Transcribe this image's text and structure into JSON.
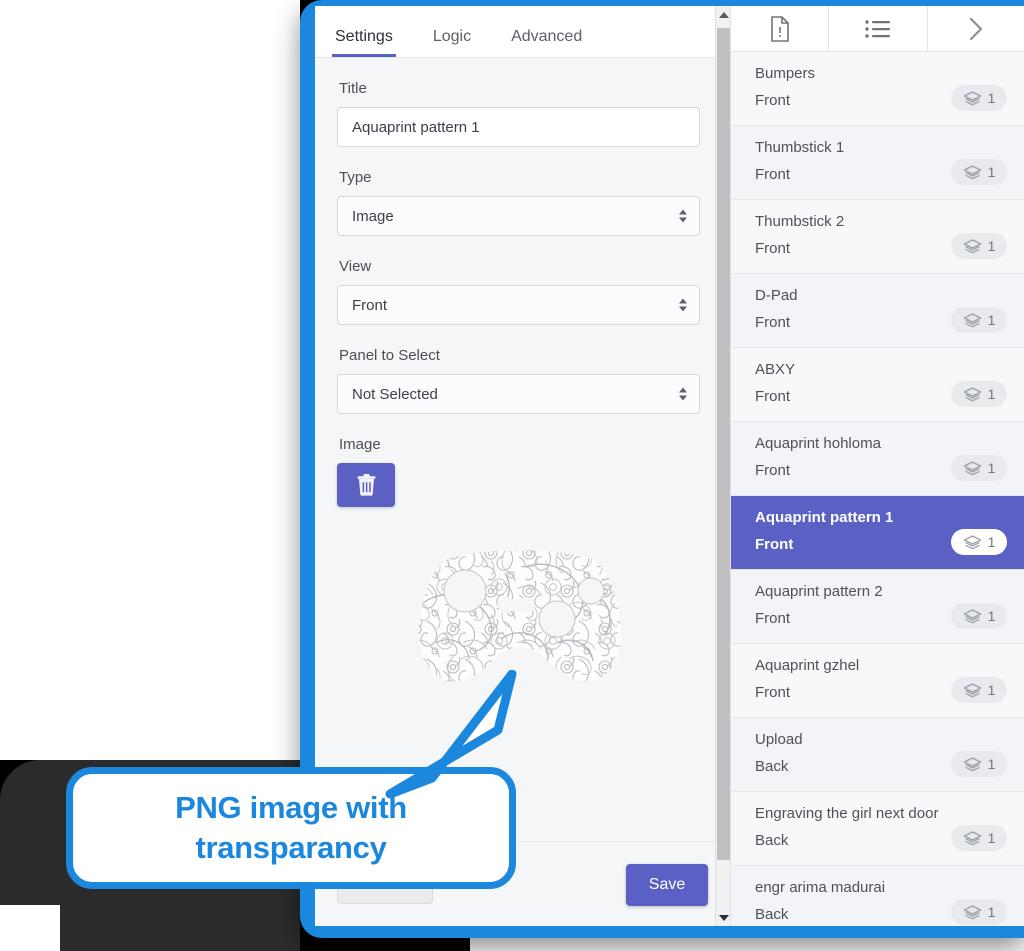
{
  "window": {
    "frame_color": "#1b87dd",
    "accent_color": "#5b61c4"
  },
  "settings_panel": {
    "tabs": [
      {
        "label": "Settings",
        "active": true
      },
      {
        "label": "Logic",
        "active": false
      },
      {
        "label": "Advanced",
        "active": false
      }
    ],
    "fields": {
      "title": {
        "label": "Title",
        "value": "Aquaprint pattern 1",
        "placeholder": "Title"
      },
      "type": {
        "label": "Type",
        "value": "Image"
      },
      "view": {
        "label": "View",
        "value": "Front"
      },
      "panel_to_select": {
        "label": "Panel to Select",
        "value": "Not Selected"
      },
      "image": {
        "label": "Image"
      }
    },
    "buttons": {
      "delete_icon": "trash-icon",
      "cancel_label": "",
      "save_label": "Save"
    }
  },
  "list_panel": {
    "toolbar": [
      {
        "icon": "document-icon",
        "name": "add-document-button"
      },
      {
        "icon": "list-icon",
        "name": "list-view-button"
      },
      {
        "icon": "chevron-right-icon",
        "name": "collapse-panel-button"
      }
    ],
    "items": [
      {
        "title": "Bumpers",
        "view": "Front",
        "count": "1",
        "selected": false
      },
      {
        "title": "Thumbstick 1",
        "view": "Front",
        "count": "1",
        "selected": false
      },
      {
        "title": "Thumbstick 2",
        "view": "Front",
        "count": "1",
        "selected": false
      },
      {
        "title": "D-Pad",
        "view": "Front",
        "count": "1",
        "selected": false
      },
      {
        "title": "ABXY",
        "view": "Front",
        "count": "1",
        "selected": false
      },
      {
        "title": "Aquaprint hohloma",
        "view": "Front",
        "count": "1",
        "selected": false
      },
      {
        "title": "Aquaprint pattern 1",
        "view": "Front",
        "count": "1",
        "selected": true
      },
      {
        "title": "Aquaprint pattern 2",
        "view": "Front",
        "count": "1",
        "selected": false
      },
      {
        "title": "Aquaprint gzhel",
        "view": "Front",
        "count": "1",
        "selected": false
      },
      {
        "title": "Upload",
        "view": "Back",
        "count": "1",
        "selected": false
      },
      {
        "title": "Engraving the girl next door",
        "view": "Back",
        "count": "1",
        "selected": false
      },
      {
        "title": "engr arima madurai",
        "view": "Back",
        "count": "1",
        "selected": false
      }
    ]
  },
  "callout": {
    "line1": "PNG image with",
    "line2": "transparancy",
    "color": "#1b87dd"
  }
}
